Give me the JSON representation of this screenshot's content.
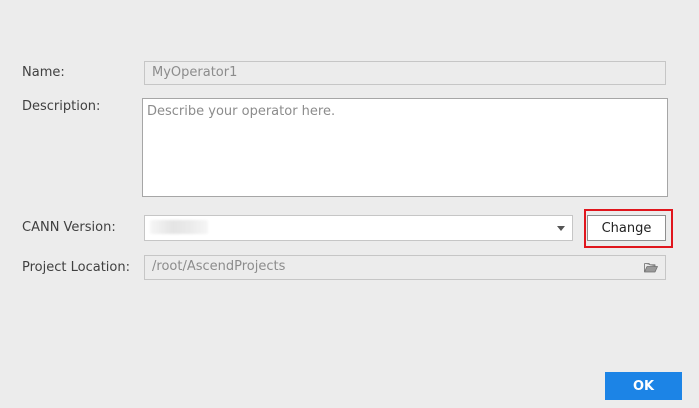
{
  "form": {
    "name_label": "Name:",
    "name_value": "MyOperator1",
    "description_label": "Description:",
    "description_placeholder": "Describe your operator here.",
    "cann_label": "CANN Version:",
    "cann_value": "",
    "change_button": "Change",
    "location_label": "Project Location:",
    "location_value": "/root/AscendProjects"
  },
  "footer": {
    "ok_button": "OK"
  },
  "icons": {
    "cann_dropdown": "chevron-down-icon",
    "location_browse": "folder-open-icon"
  },
  "colors": {
    "background": "#ececec",
    "accent": "#1c84e6",
    "highlight": "#e0161d"
  }
}
